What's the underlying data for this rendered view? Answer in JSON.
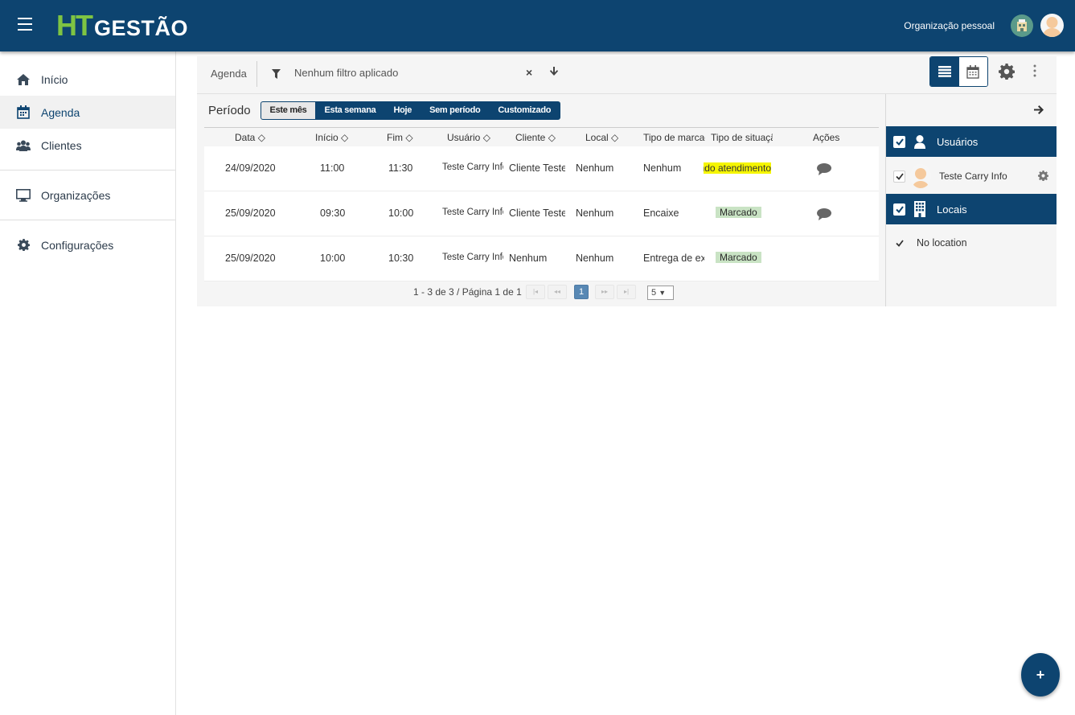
{
  "brand": {
    "logo_ht": "HT",
    "logo_gestao": "GESTÃO"
  },
  "header": {
    "org_name": "Organização pessoal"
  },
  "sidebar": {
    "items": [
      {
        "label": "Início",
        "icon": "home-icon"
      },
      {
        "label": "Agenda",
        "icon": "calendar-icon",
        "active": true
      },
      {
        "label": "Clientes",
        "icon": "users-icon"
      },
      {
        "label": "Organizações",
        "icon": "monitor-icon"
      },
      {
        "label": "Configurações",
        "icon": "gear-icon"
      }
    ]
  },
  "toolbar": {
    "title": "Agenda",
    "filter_text": "Nenhum filtro aplicado",
    "clear_glyph": "×"
  },
  "period": {
    "label": "Período",
    "options": [
      "Este mês",
      "Esta semana",
      "Hoje",
      "Sem período",
      "Customizado"
    ],
    "selected": "Este mês"
  },
  "table": {
    "headers": [
      "Data",
      "Início",
      "Fim",
      "Usuário",
      "Cliente",
      "Local",
      "Tipo de marcação",
      "Tipo de situação",
      "Ações"
    ],
    "rows": [
      {
        "data": "24/09/2020",
        "inicio": "11:00",
        "fim": "11:30",
        "usuario": "Teste Carry Info",
        "cliente": "Cliente Teste",
        "local": "Nenhum",
        "tipo_marcacao": "Nenhum",
        "situacao": "Aguardando atendimento",
        "situacao_style": "yellow",
        "has_comment": true
      },
      {
        "data": "25/09/2020",
        "inicio": "09:30",
        "fim": "10:00",
        "usuario": "Teste Carry Info",
        "cliente": "Cliente Teste",
        "local": "Nenhum",
        "tipo_marcacao": "Encaixe",
        "situacao": "Marcado",
        "situacao_style": "badge",
        "has_comment": true
      },
      {
        "data": "25/09/2020",
        "inicio": "10:00",
        "fim": "10:30",
        "usuario": "Teste Carry Info",
        "cliente": "Nenhum",
        "local": "Nenhum",
        "tipo_marcacao": "Entrega de exame",
        "situacao": "Marcado",
        "situacao_style": "badge",
        "has_comment": false
      }
    ]
  },
  "pager": {
    "info": "1 - 3 de 3 / Página 1 de 1",
    "current_page": "1",
    "page_size": "5"
  },
  "right_panel": {
    "users_header": "Usuários",
    "users": [
      "Teste Carry Info"
    ],
    "locations_header": "Locais",
    "locations": [
      "No location"
    ]
  },
  "fab": {
    "label": "+"
  },
  "colors": {
    "primary": "#0d4470",
    "brand_green": "#7ec443",
    "status_yellow": "#f5f500",
    "status_badge": "#c9e3c4"
  }
}
